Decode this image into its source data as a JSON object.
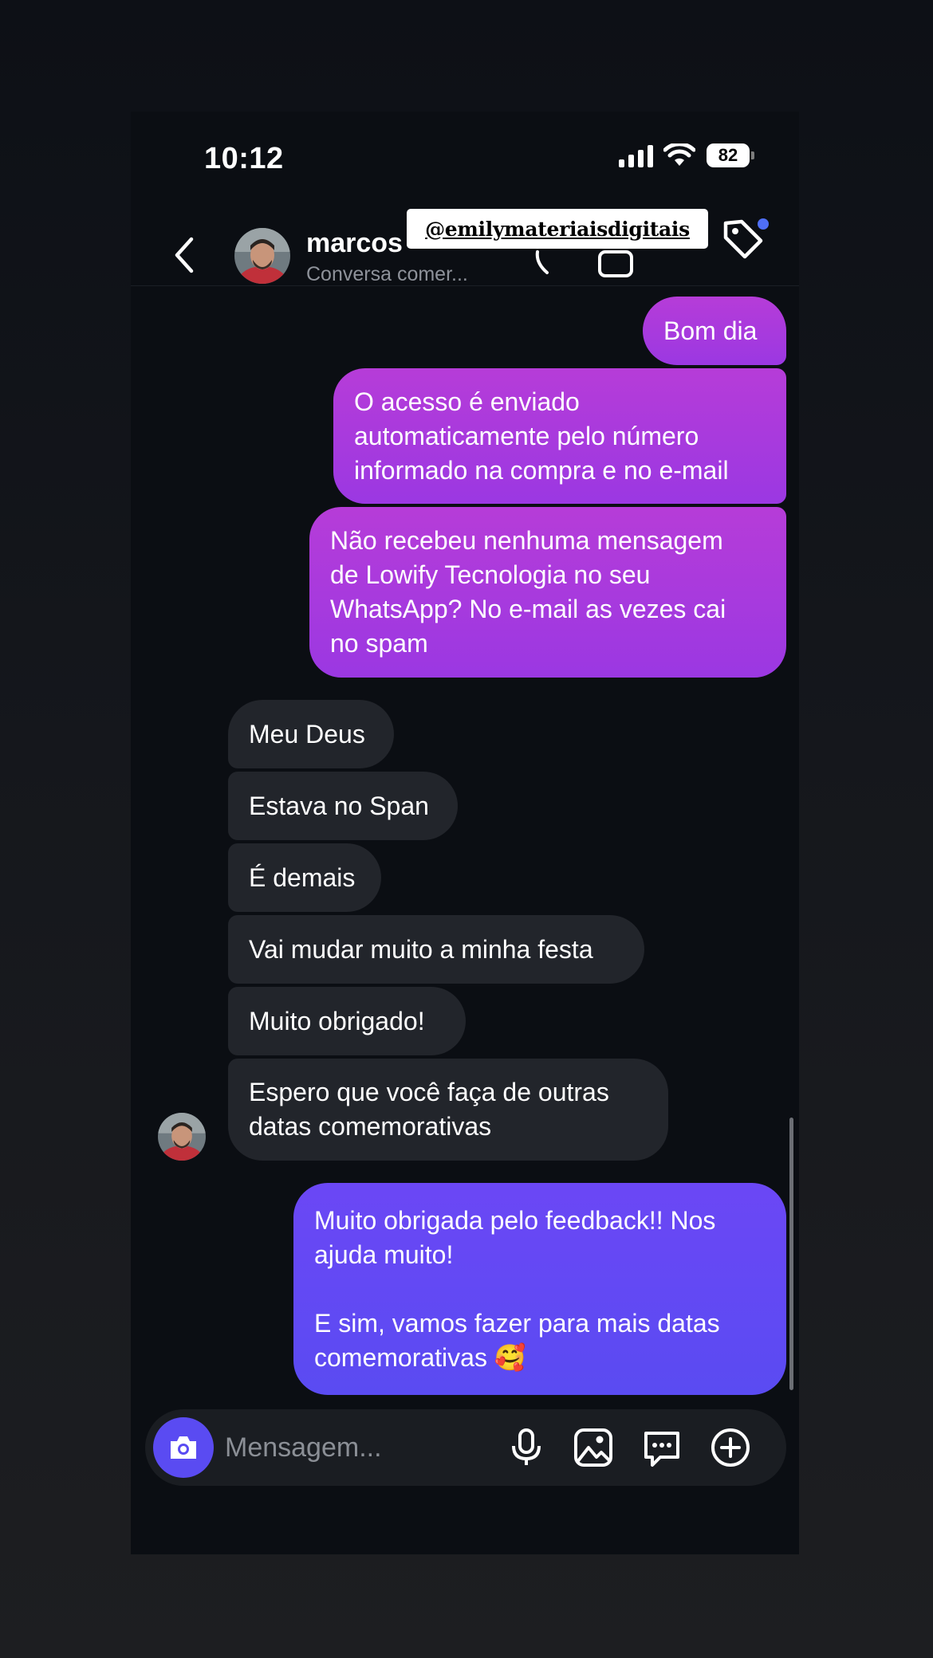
{
  "status_bar": {
    "time": "10:12",
    "battery": "82"
  },
  "header": {
    "contact_name": "marcos",
    "subtitle": "Conversa comer...",
    "overlay_handle": "@emilymateriaisdigitais"
  },
  "messages": [
    {
      "direction": "outgoing",
      "text": "Bom dia"
    },
    {
      "direction": "outgoing",
      "text": "O acesso é enviado\nautomaticamente pelo número\ninformado na compra e no e-mail"
    },
    {
      "direction": "outgoing",
      "text": "Não recebeu nenhuma mensagem\nde Lowify Tecnologia no seu\nWhatsApp? No e-mail as vezes cai\nno spam"
    },
    {
      "direction": "incoming",
      "text": "Meu Deus"
    },
    {
      "direction": "incoming",
      "text": "Estava no Span"
    },
    {
      "direction": "incoming",
      "text": "É demais"
    },
    {
      "direction": "incoming",
      "text": "Vai mudar muito a minha festa"
    },
    {
      "direction": "incoming",
      "text": "Muito obrigado!"
    },
    {
      "direction": "incoming",
      "text": "Espero que você faça de outras\ndatas comemorativas"
    },
    {
      "direction": "outgoing",
      "text": "Muito obrigada pelo feedback!! Nos\najuda muito!\n\nE sim, vamos fazer para mais datas\ncomemorativas 🥰"
    }
  ],
  "composer": {
    "placeholder": "Mensagem..."
  },
  "icons": {
    "back": "chevron-left-icon",
    "tag": "tag-icon",
    "camera": "camera-icon",
    "microphone": "microphone-icon",
    "gallery": "image-icon",
    "sticker": "chat-bubble-icon",
    "more": "plus-circle-icon"
  },
  "colors": {
    "outgoing_purple": "#b63cd8",
    "outgoing_blue": "#5a4bf2",
    "incoming": "#22252b",
    "accent_dot": "#4f6ff7"
  }
}
